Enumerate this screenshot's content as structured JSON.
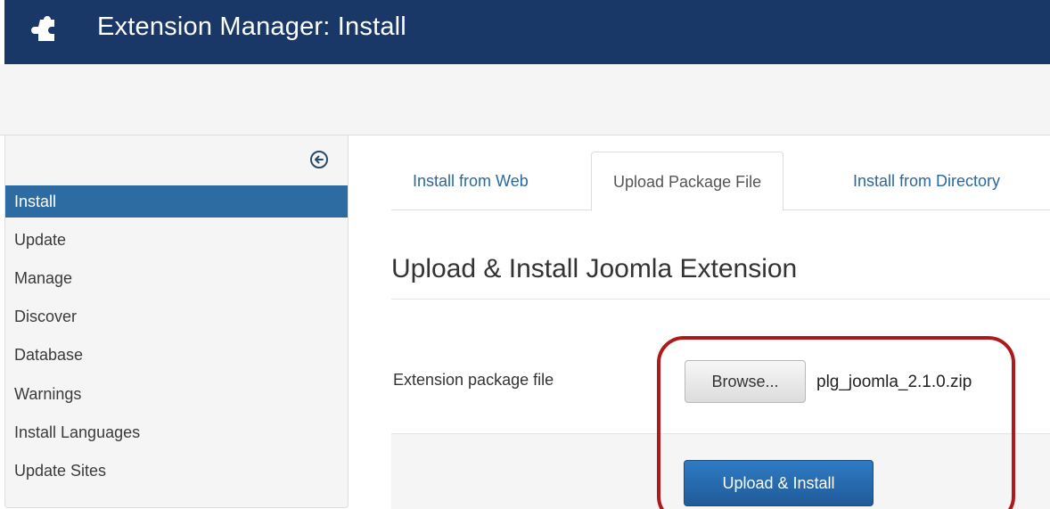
{
  "header": {
    "icon": "puzzle-piece-icon",
    "title": "Extension Manager: Install",
    "background": "#1a3867"
  },
  "sidebar": {
    "toggle_icon": "collapse-arrow-icon",
    "items": [
      {
        "label": "Install",
        "active": true
      },
      {
        "label": "Update",
        "active": false
      },
      {
        "label": "Manage",
        "active": false
      },
      {
        "label": "Discover",
        "active": false
      },
      {
        "label": "Database",
        "active": false
      },
      {
        "label": "Warnings",
        "active": false
      },
      {
        "label": "Install Languages",
        "active": false
      },
      {
        "label": "Update Sites",
        "active": false
      }
    ],
    "active_color": "#2d6ca2"
  },
  "tabs": [
    {
      "label": "Install from Web",
      "active": false
    },
    {
      "label": "Upload Package File",
      "active": true
    },
    {
      "label": "Install from Directory",
      "active": false
    }
  ],
  "form": {
    "legend": "Upload & Install Joomla Extension",
    "field_label": "Extension package file",
    "browse_label": "Browse...",
    "selected_file": "plg_joomla_2.1.0.zip",
    "submit_label": "Upload & Install"
  },
  "annotation": {
    "highlight_color": "#b01919"
  }
}
